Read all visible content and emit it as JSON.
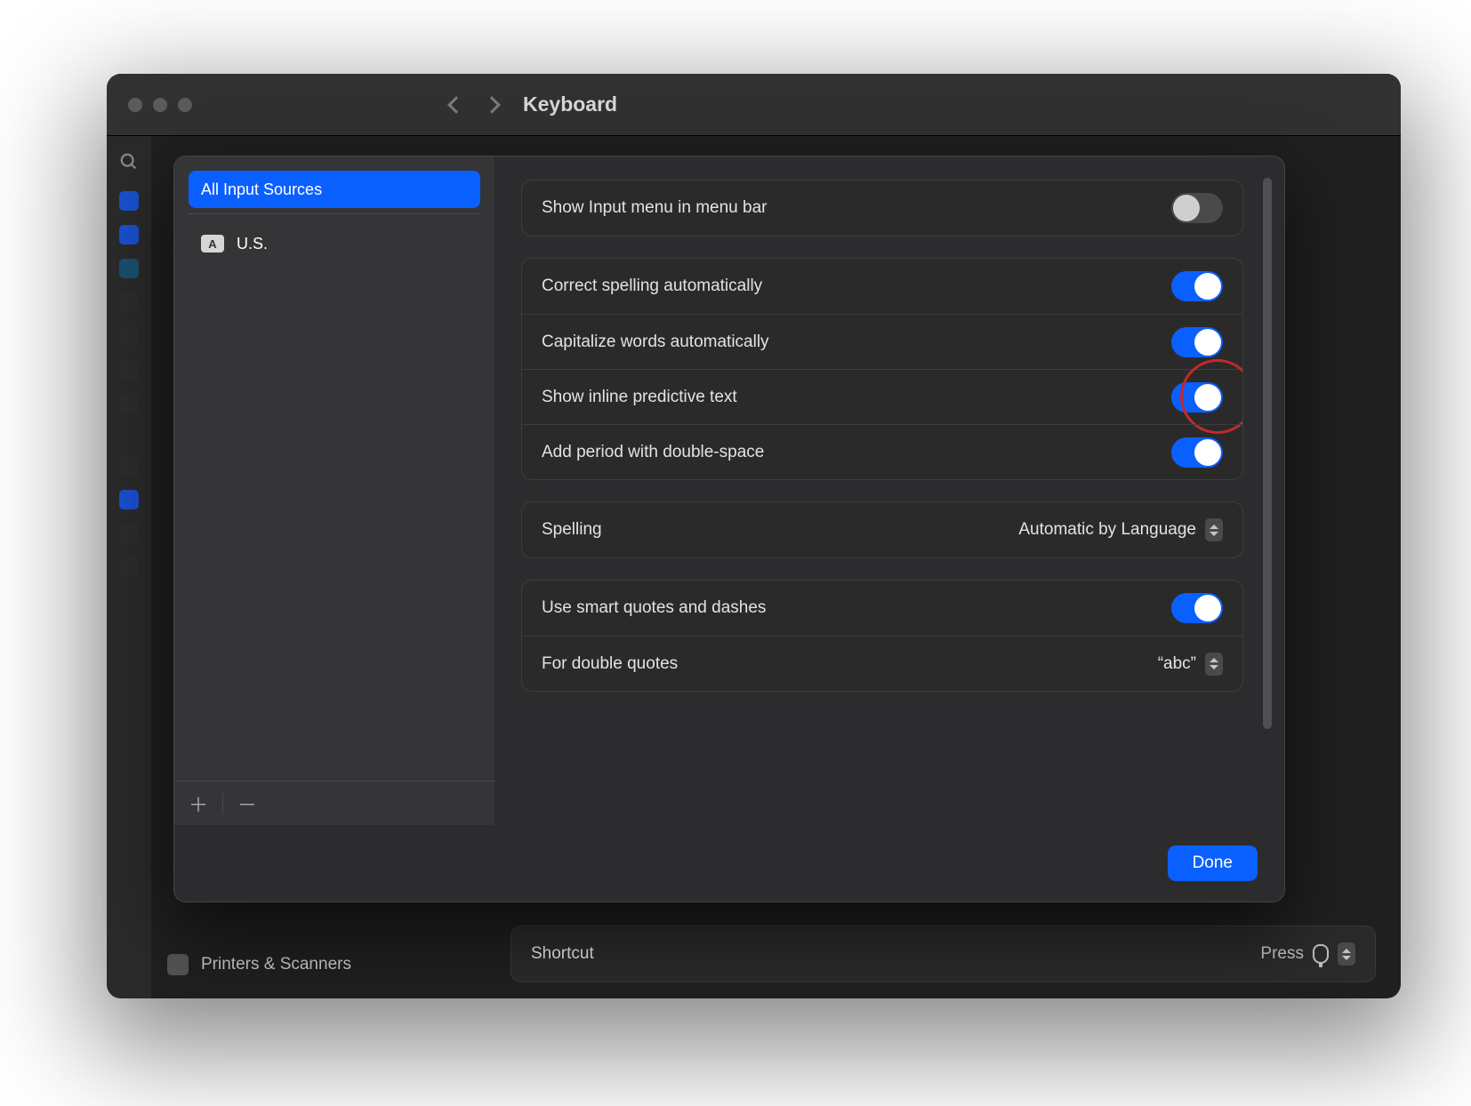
{
  "window": {
    "title": "Keyboard",
    "sidebar_bottom": "Printers & Scanners",
    "shortcut_row": {
      "label": "Shortcut",
      "value": "Press"
    }
  },
  "sheet": {
    "sidebar": {
      "all_sources": "All Input Sources",
      "items": [
        {
          "label": "U.S.",
          "flag": "A"
        }
      ],
      "add_icon_tooltip": "Add",
      "remove_icon_tooltip": "Remove"
    },
    "settings": {
      "show_input_menu": {
        "label": "Show Input menu in menu bar",
        "on": false
      },
      "correct_spelling": {
        "label": "Correct spelling automatically",
        "on": true
      },
      "capitalize_words": {
        "label": "Capitalize words automatically",
        "on": true
      },
      "predictive_text": {
        "label": "Show inline predictive text",
        "on": true,
        "highlighted": true
      },
      "add_period": {
        "label": "Add period with double-space",
        "on": true
      },
      "spelling": {
        "label": "Spelling",
        "value": "Automatic by Language"
      },
      "smart_quotes": {
        "label": "Use smart quotes and dashes",
        "on": true
      },
      "double_quotes": {
        "label": "For double quotes",
        "value": "“abc”"
      }
    },
    "done": "Done"
  }
}
